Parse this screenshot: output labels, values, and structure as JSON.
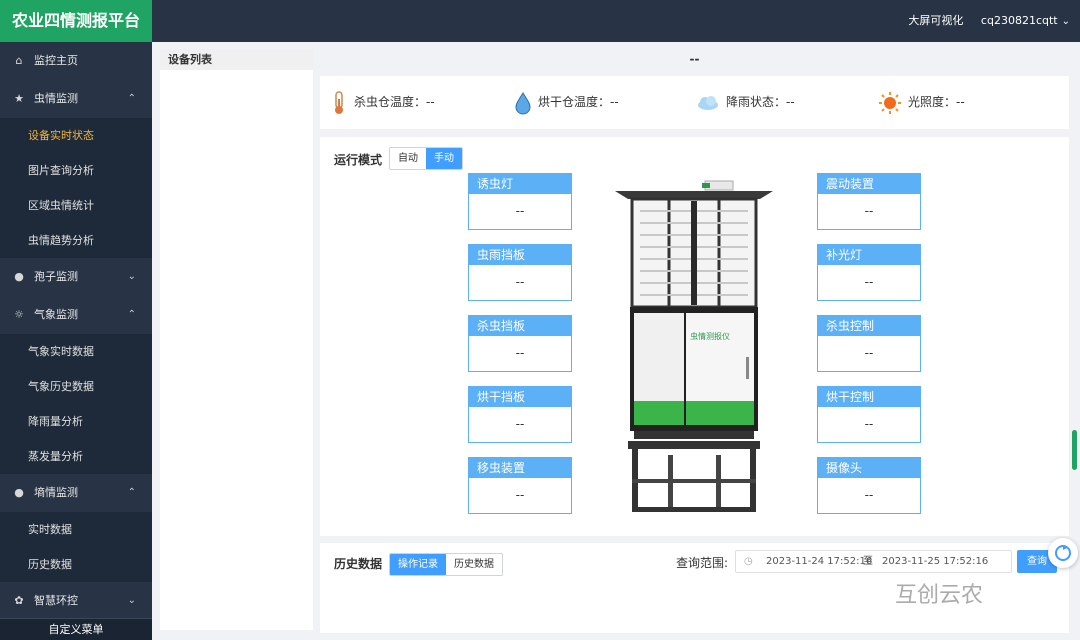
{
  "app": {
    "title": "农业四情测报平台"
  },
  "header": {
    "bigscreen_label": "大屏可视化",
    "username": "cq230821cqtt"
  },
  "sidebar": {
    "items": [
      {
        "label": "监控主页",
        "icon": "home-icon"
      },
      {
        "label": "虫情监测",
        "icon": "bug-icon",
        "expanded": true,
        "children": [
          "设备实时状态",
          "图片查询分析",
          "区域虫情统计",
          "虫情趋势分析"
        ]
      },
      {
        "label": "孢子监测",
        "icon": "globe-icon",
        "expanded": false
      },
      {
        "label": "气象监测",
        "icon": "sun-icon",
        "expanded": true,
        "children": [
          "气象实时数据",
          "气象历史数据",
          "降雨量分析",
          "蒸发量分析"
        ]
      },
      {
        "label": "墒情监测",
        "icon": "globe-icon",
        "expanded": true,
        "children": [
          "实时数据",
          "历史数据"
        ]
      },
      {
        "label": "智慧环控",
        "icon": "leaf-icon",
        "expanded": false
      }
    ],
    "active_item": "设备实时状态",
    "footer": "自定义菜单"
  },
  "device_list": {
    "title": "设备列表"
  },
  "main": {
    "title": "--",
    "stats": [
      {
        "label": "杀虫仓温度：",
        "value": "--",
        "icon": "thermometer-icon"
      },
      {
        "label": "烘干仓温度：",
        "value": "--",
        "icon": "water-drop-icon"
      },
      {
        "label": "降雨状态：",
        "value": "--",
        "icon": "cloud-icon"
      },
      {
        "label": "光照度：",
        "value": "--",
        "icon": "sun-icon"
      }
    ],
    "mode": {
      "label": "运行模式",
      "options": [
        "自动",
        "手动"
      ],
      "selected": "手动"
    },
    "controls_left": [
      {
        "label": "诱虫灯",
        "value": "--"
      },
      {
        "label": "虫雨挡板",
        "value": "--"
      },
      {
        "label": "杀虫挡板",
        "value": "--"
      },
      {
        "label": "烘干挡板",
        "value": "--"
      },
      {
        "label": "移虫装置",
        "value": "--"
      }
    ],
    "controls_right": [
      {
        "label": "震动装置",
        "value": "--"
      },
      {
        "label": "补光灯",
        "value": "--"
      },
      {
        "label": "杀虫控制",
        "value": "--"
      },
      {
        "label": "烘干控制",
        "value": "--"
      },
      {
        "label": "摄像头",
        "value": "--"
      }
    ],
    "device_image_text": "虫情测报仪"
  },
  "history": {
    "title": "历史数据",
    "tabs": [
      "操作记录",
      "历史数据"
    ],
    "selected_tab": "操作记录",
    "range_label": "查询范围:",
    "range_start": "2023-11-24 17:52:16",
    "range_sep": "至",
    "range_end": "2023-11-25 17:52:16",
    "query_label": "查询"
  },
  "watermark": "互创云农",
  "colors": {
    "brand": "#1fa463",
    "sidebar_bg": "#283445",
    "accent": "#409eff",
    "card_header": "#5cb0f5",
    "active_menu": "#f2b63b"
  }
}
